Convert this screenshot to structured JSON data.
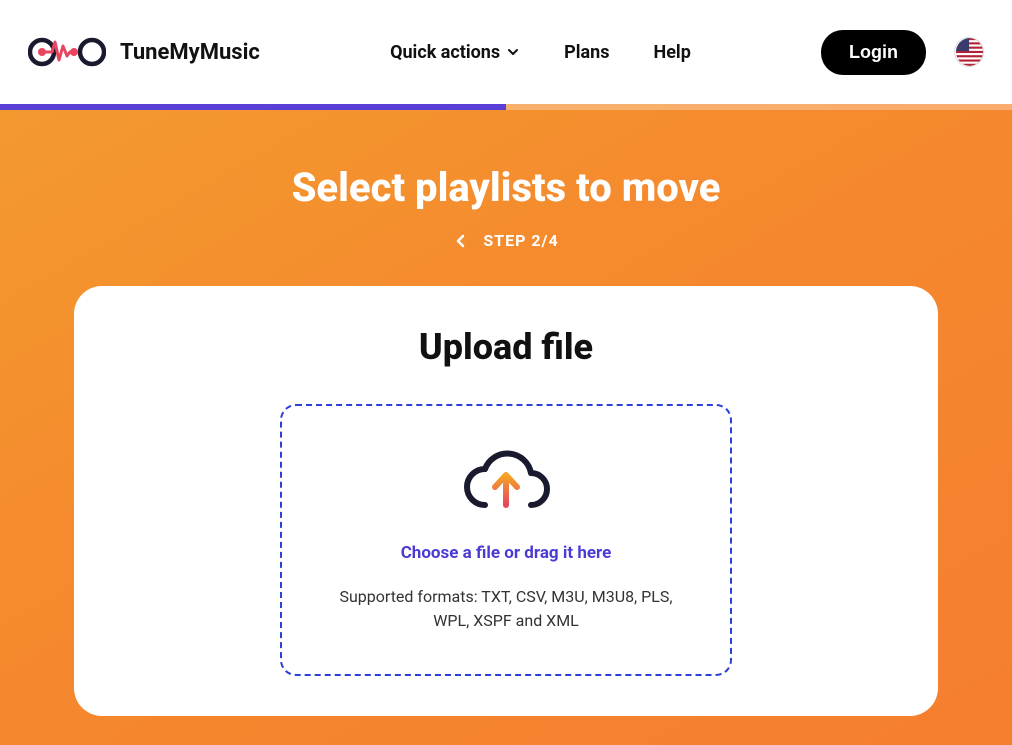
{
  "brand": {
    "name": "TuneMyMusic"
  },
  "nav": {
    "quick_actions": "Quick actions",
    "plans": "Plans",
    "help": "Help",
    "login": "Login"
  },
  "page": {
    "title": "Select playlists to move",
    "step_label": "STEP 2/4"
  },
  "upload": {
    "card_title": "Upload file",
    "choose_text": "Choose a file or drag it here",
    "formats_text": "Supported formats: TXT, CSV, M3U, M3U8, PLS, WPL, XSPF and XML"
  },
  "progress": {
    "percent": 50
  }
}
